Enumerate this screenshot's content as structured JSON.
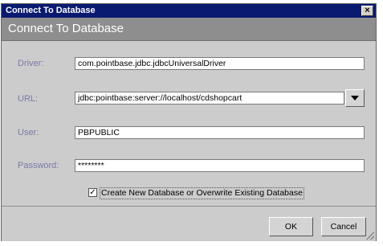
{
  "window": {
    "title": "Connect To Database",
    "close_glyph": "×"
  },
  "header": {
    "title": "Connect To Database"
  },
  "form": {
    "driver": {
      "label": "Driver:",
      "value": "com.pointbase.jdbc.jdbcUniversalDriver"
    },
    "url": {
      "label": "URL:",
      "value": "jdbc:pointbase:server://localhost/cdshopcart"
    },
    "user": {
      "label": "User:",
      "value": "PBPUBLIC"
    },
    "password": {
      "label": "Password:",
      "value": "********"
    },
    "create_db": {
      "label": "Create New Database or Overwrite Existing Database",
      "checked": true,
      "check_glyph": "✓"
    }
  },
  "buttons": {
    "ok": "OK",
    "cancel": "Cancel"
  },
  "colors": {
    "titlebar": "#0a1a70",
    "header": "#8e8e8e",
    "background": "#cccccc",
    "label": "#7a7aa8"
  }
}
